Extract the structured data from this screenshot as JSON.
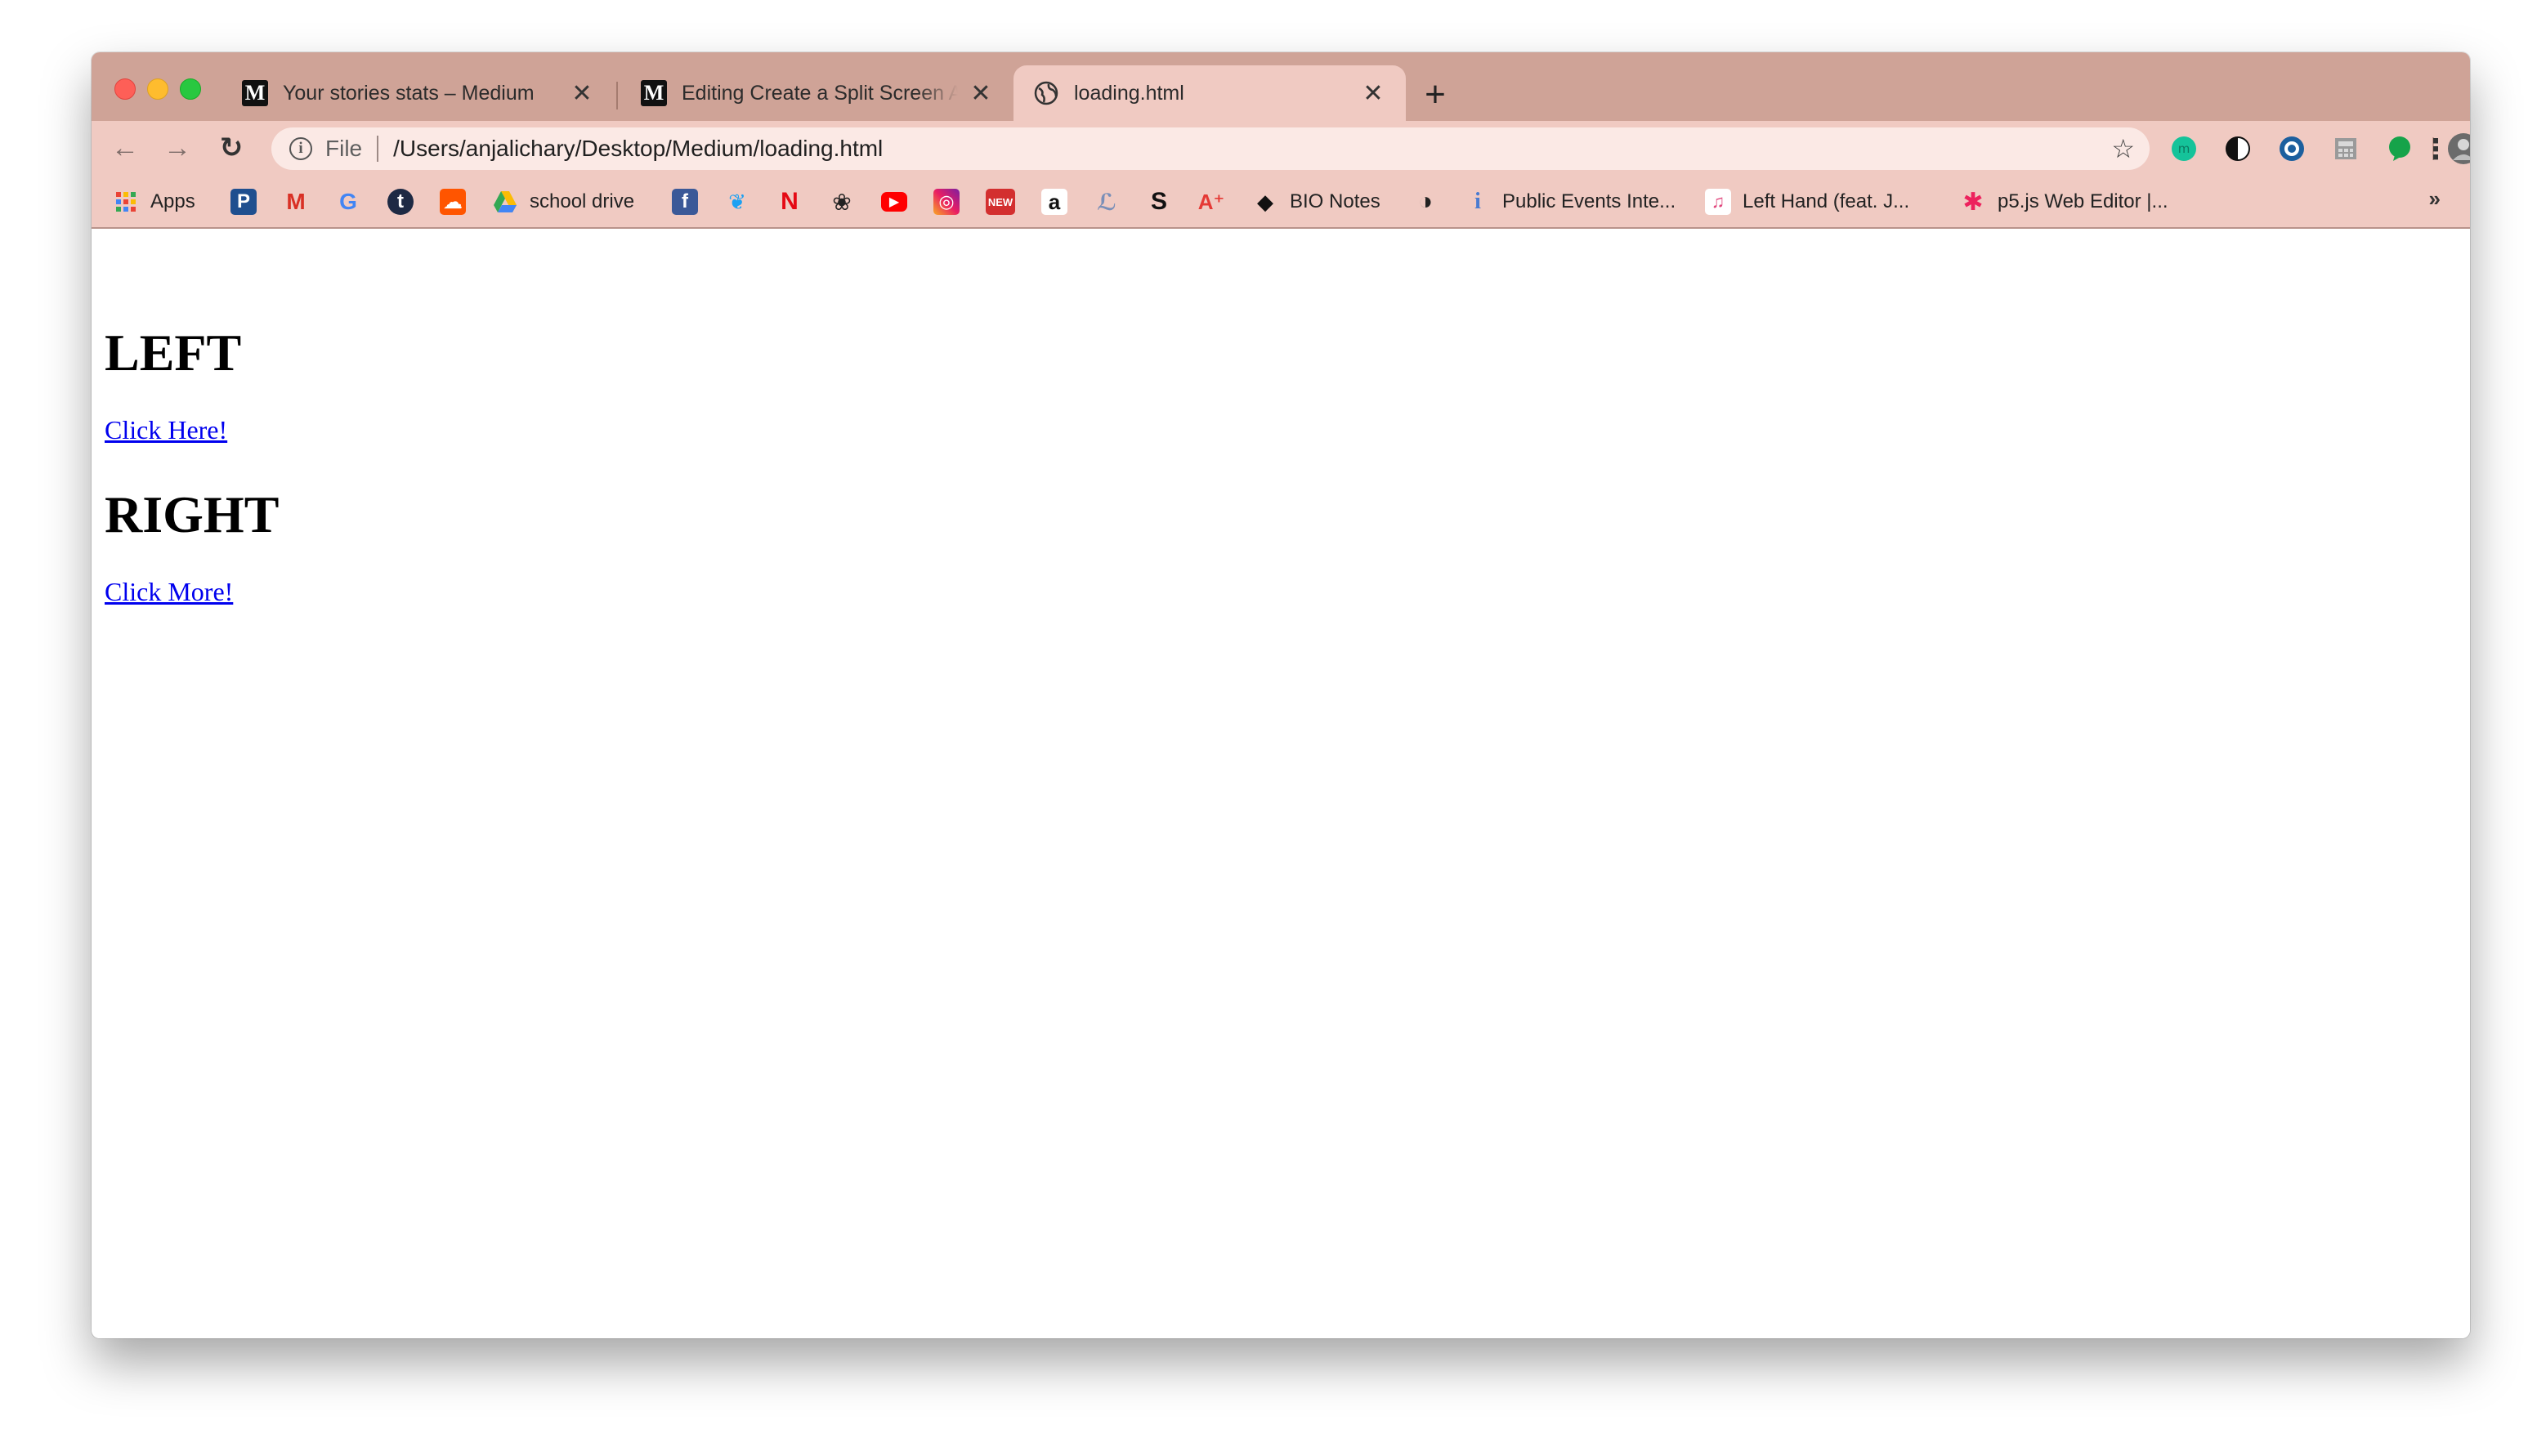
{
  "tabs": [
    {
      "title": "Your stories stats – Medium",
      "icon": "medium-icon",
      "active": false
    },
    {
      "title": "Editing Create a Split Screen A",
      "icon": "medium-icon",
      "active": false
    },
    {
      "title": "loading.html",
      "icon": "globe-icon",
      "active": true
    }
  ],
  "tab_close_glyph": "✕",
  "newtab_glyph": "+",
  "toolbar": {
    "back_glyph": "←",
    "forward_glyph": "→",
    "reload_glyph": "↻",
    "info_glyph": "i",
    "scheme": "File",
    "url": "/Users/anjalichary/Desktop/Medium/loading.html",
    "star_glyph": "☆",
    "menu_glyph": "⋮"
  },
  "extensions": [
    "grammarly-icon",
    "dark-mode-icon",
    "eye-icon",
    "calculator-icon",
    "chat-bubble-icon",
    "profile-avatar-icon"
  ],
  "bookmarks": [
    {
      "label": "Apps",
      "icon": "apps-grid-icon"
    },
    {
      "label": "",
      "icon": "pinterest-p-icon",
      "glyph": "P"
    },
    {
      "label": "",
      "icon": "gmail-icon",
      "glyph": "M"
    },
    {
      "label": "",
      "icon": "google-icon",
      "glyph": "G"
    },
    {
      "label": "",
      "icon": "tumblr-icon",
      "glyph": "t"
    },
    {
      "label": "",
      "icon": "soundcloud-icon",
      "glyph": "☁"
    },
    {
      "label": "school drive",
      "icon": "google-drive-icon"
    },
    {
      "label": "",
      "icon": "facebook-icon",
      "glyph": "f"
    },
    {
      "label": "",
      "icon": "twitter-icon",
      "glyph": "❦"
    },
    {
      "label": "",
      "icon": "netflix-icon",
      "glyph": "N"
    },
    {
      "label": "",
      "icon": "openai-icon",
      "glyph": "❀"
    },
    {
      "label": "",
      "icon": "youtube-icon",
      "glyph": "▶"
    },
    {
      "label": "",
      "icon": "instagram-icon",
      "glyph": "◎"
    },
    {
      "label": "",
      "icon": "news-icon",
      "glyph": "NEW"
    },
    {
      "label": "",
      "icon": "amazon-icon",
      "glyph": "a"
    },
    {
      "label": "",
      "icon": "script-icon",
      "glyph": "ℒ"
    },
    {
      "label": "",
      "icon": "squarespace-icon",
      "glyph": "S"
    },
    {
      "label": "",
      "icon": "grade-a-plus-icon",
      "glyph": "A⁺"
    },
    {
      "label": "BIO Notes",
      "icon": "graduation-cap-icon",
      "glyph": "◆"
    },
    {
      "label": "",
      "icon": "globe-icon",
      "glyph": "◑"
    },
    {
      "label": "Public Events Inte...",
      "icon": "info-figure-icon",
      "glyph": "i"
    },
    {
      "label": "Left Hand (feat. J...",
      "icon": "music-note-icon",
      "glyph": "♫"
    },
    {
      "label": "p5.js Web Editor |...",
      "icon": "asterisk-icon",
      "glyph": "✱"
    }
  ],
  "bookmarks_more": "»",
  "page": {
    "heading_left": "LEFT",
    "link_left": "Click Here!",
    "heading_right": "RIGHT",
    "link_right": "Click More!"
  },
  "colors": {
    "tabstrip": "#cfa397",
    "toolbar": "#f0cac2",
    "link": "#0000ee"
  }
}
